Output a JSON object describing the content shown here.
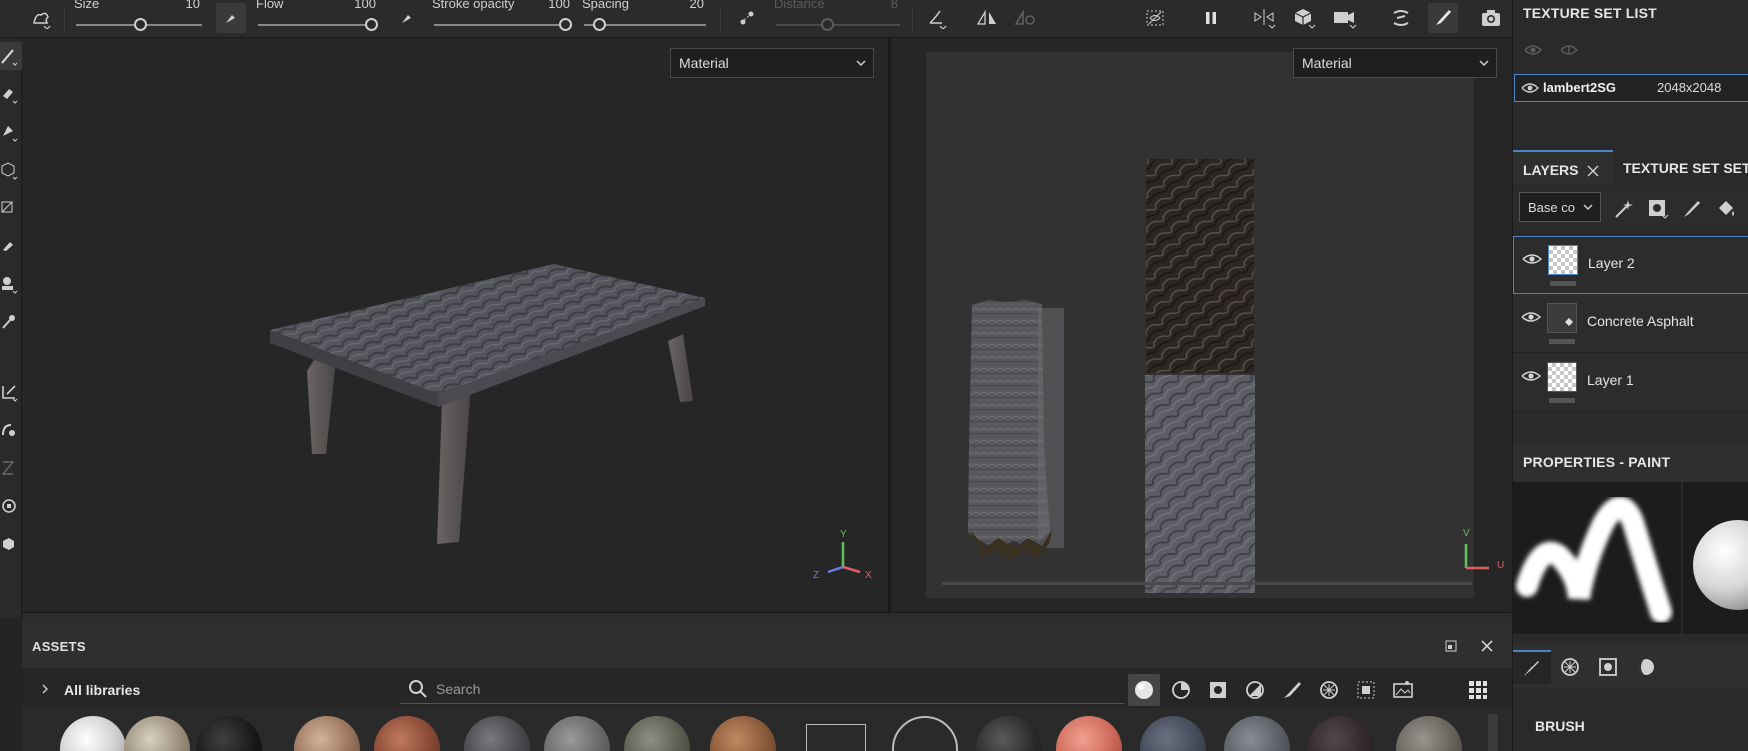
{
  "toolbar": {
    "size": {
      "label": "Size",
      "value": "10",
      "fraction": 0.52
    },
    "flow": {
      "label": "Flow",
      "value": "100",
      "fraction": 1.0
    },
    "stroke_opacity": {
      "label": "Stroke opacity",
      "value": "100",
      "fraction": 1.0
    },
    "spacing": {
      "label": "Spacing",
      "value": "20",
      "fraction": 0.1
    },
    "distance": {
      "label": "Distance",
      "value": "8",
      "fraction": 0.42
    }
  },
  "viewport3d": {
    "mode": "Material",
    "axes": {
      "y": "Y",
      "x": "X",
      "z": "Z"
    }
  },
  "viewport2d": {
    "mode": "Material",
    "axes": {
      "v": "V",
      "u": "U"
    }
  },
  "assets": {
    "title": "ASSETS",
    "libraries": "All libraries",
    "search_placeholder": "Search"
  },
  "texture_set_list": {
    "title": "TEXTURE SET LIST",
    "items": [
      {
        "name": "lambert2SG",
        "resolution": "2048x2048"
      }
    ]
  },
  "tabs": {
    "layers": "LAYERS",
    "settings": "TEXTURE SET SET"
  },
  "layers": {
    "channel": "Base co",
    "items": [
      {
        "name": "Layer 2",
        "selected": true
      },
      {
        "name": "Concrete Asphalt",
        "selected": false
      },
      {
        "name": "Layer 1",
        "selected": false
      }
    ]
  },
  "properties": {
    "title": "PROPERTIES - PAINT",
    "section": "BRUSH"
  },
  "colors": {
    "accent": "#4b84c8",
    "axis_x": "#e06060",
    "axis_y": "#60c060",
    "axis_z": "#6b7fe0"
  }
}
